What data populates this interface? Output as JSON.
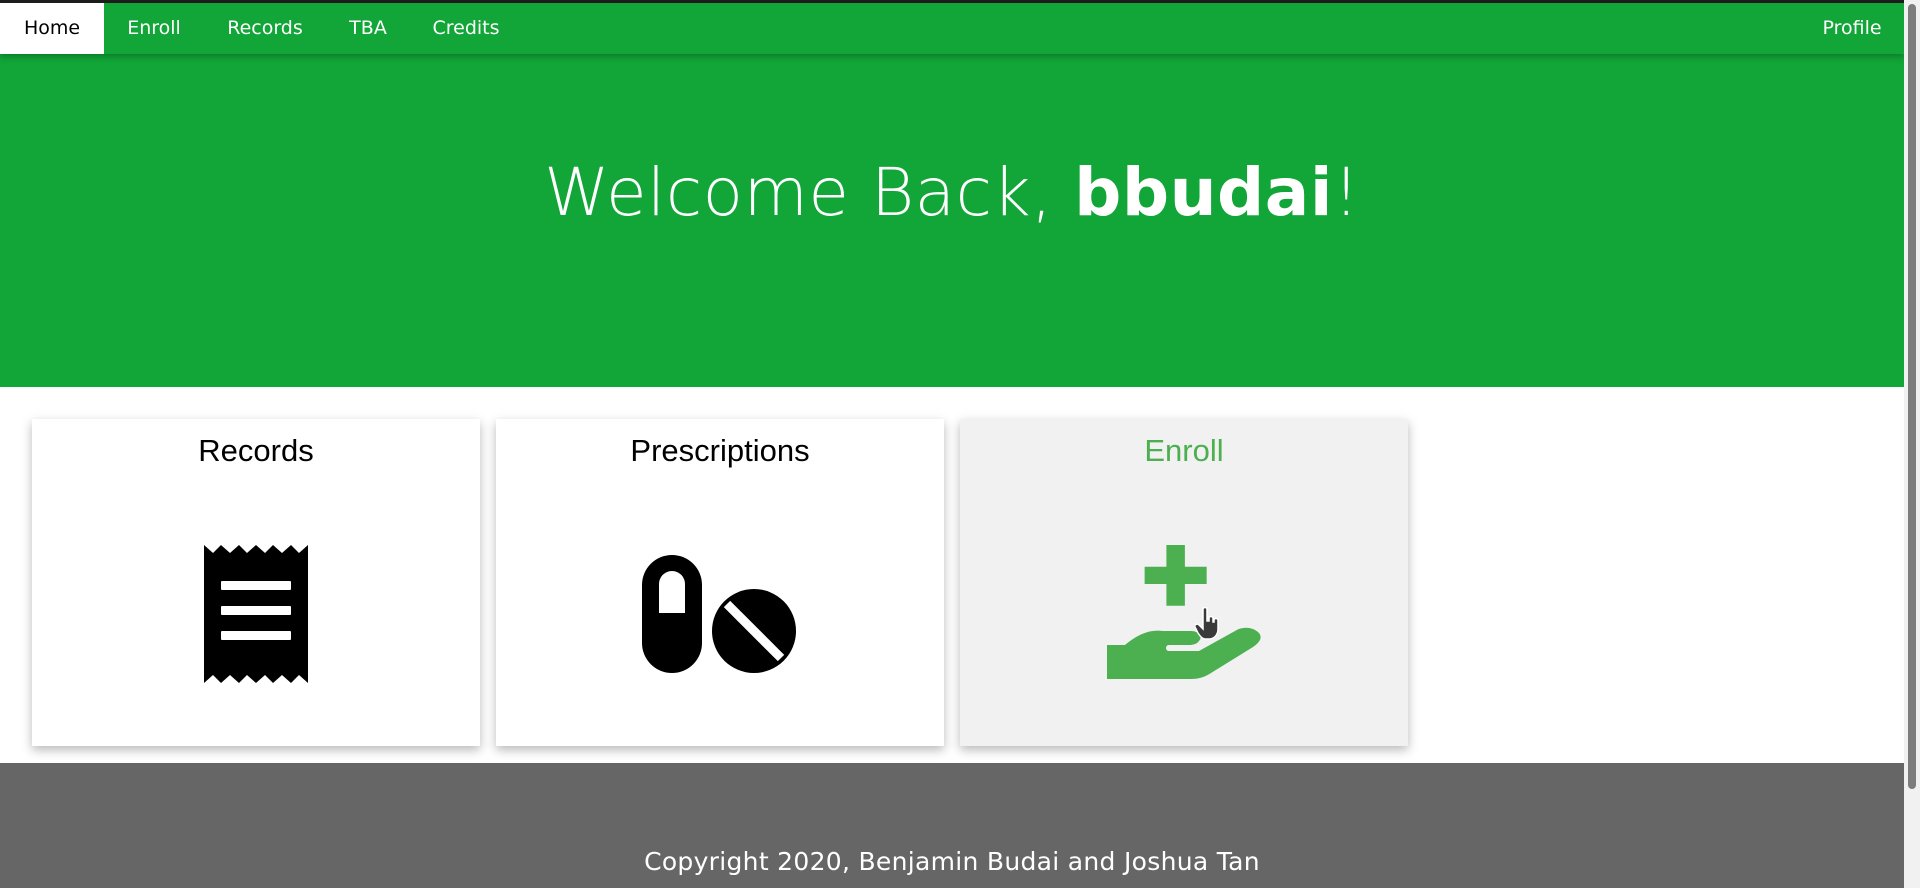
{
  "nav": {
    "items": [
      {
        "label": "Home",
        "active": true
      },
      {
        "label": "Enroll",
        "active": false
      },
      {
        "label": "Records",
        "active": false
      },
      {
        "label": "TBA",
        "active": false
      },
      {
        "label": "Credits",
        "active": false
      }
    ],
    "profile_label": "Profile"
  },
  "hero": {
    "greeting": "Welcome Back, ",
    "username": "bbudai",
    "punctuation": "!"
  },
  "cards": [
    {
      "title": "Records",
      "icon": "receipt-icon"
    },
    {
      "title": "Prescriptions",
      "icon": "pills-icon"
    },
    {
      "title": "Enroll",
      "icon": "hand-holding-medical-icon",
      "hovered": true
    }
  ],
  "footer": {
    "copyright": "Copyright 2020, Benjamin Budai and Joshua Tan"
  },
  "colors": {
    "brand_green": "#11a637",
    "accent_green": "#4caf50",
    "footer_gray": "#666666"
  }
}
